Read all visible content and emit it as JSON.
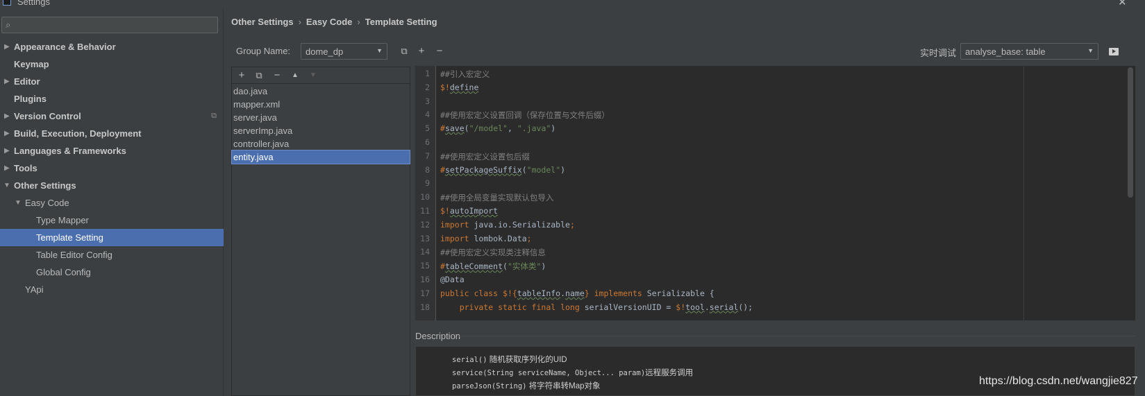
{
  "window": {
    "title": "Settings",
    "close_glyph": "✕"
  },
  "search": {
    "placeholder": "",
    "icon": "search-icon"
  },
  "sidebar": {
    "items": [
      {
        "label": "Appearance & Behavior",
        "arrow": "▶"
      },
      {
        "label": "Keymap",
        "arrow": ""
      },
      {
        "label": "Editor",
        "arrow": "▶"
      },
      {
        "label": "Plugins",
        "arrow": ""
      },
      {
        "label": "Version Control",
        "arrow": "▶"
      },
      {
        "label": "Build, Execution, Deployment",
        "arrow": "▶"
      },
      {
        "label": "Languages & Frameworks",
        "arrow": "▶"
      },
      {
        "label": "Tools",
        "arrow": "▶"
      },
      {
        "label": "Other Settings",
        "arrow": "▼"
      },
      {
        "label": "Easy Code",
        "arrow": "▼"
      },
      {
        "label": "Type Mapper",
        "arrow": ""
      },
      {
        "label": "Template Setting",
        "arrow": ""
      },
      {
        "label": "Table Editor Config",
        "arrow": ""
      },
      {
        "label": "Global Config",
        "arrow": ""
      },
      {
        "label": "YApi",
        "arrow": ""
      }
    ],
    "copy_icon": "⧉"
  },
  "breadcrumb": {
    "items": [
      "Other Settings",
      "Easy Code",
      "Template Setting"
    ],
    "separator": "›"
  },
  "group": {
    "label": "Group Name:",
    "value": "dome_dp",
    "dropdown_glyph": "▼",
    "copy_glyph": "⧉",
    "add_glyph": "+",
    "remove_glyph": "−"
  },
  "debug": {
    "label": "实时调试",
    "value": "analyse_base: table",
    "dropdown_glyph": "▼"
  },
  "file_toolbar": {
    "add": "+",
    "copy": "⧉",
    "remove": "−",
    "up": "▲",
    "down": "▼"
  },
  "files": [
    "dao.java",
    "mapper.xml",
    "server.java",
    "serverImp.java",
    "controller.java",
    "entity.java"
  ],
  "editor": {
    "line_numbers": [
      "1",
      "2",
      "3",
      "4",
      "5",
      "6",
      "7",
      "8",
      "9",
      "10",
      "11",
      "12",
      "13",
      "14",
      "15",
      "16",
      "17",
      "18"
    ],
    "lines": [
      [
        {
          "t": "##引入宏定义",
          "c": "cmt"
        }
      ],
      [
        {
          "t": "$!",
          "c": "dir"
        },
        {
          "t": "define",
          "c": "txt",
          "s": true
        }
      ],
      [],
      [
        {
          "t": "##使用宏定义设置回调（保存位置与文件后缀）",
          "c": "cmt"
        }
      ],
      [
        {
          "t": "#",
          "c": "dir"
        },
        {
          "t": "save",
          "c": "txt",
          "s": true
        },
        {
          "t": "(",
          "c": "txt"
        },
        {
          "t": "\"/model\"",
          "c": "str"
        },
        {
          "t": ", ",
          "c": "txt"
        },
        {
          "t": "\".java\"",
          "c": "str"
        },
        {
          "t": ")",
          "c": "txt"
        }
      ],
      [],
      [
        {
          "t": "##使用宏定义设置包后缀",
          "c": "cmt"
        }
      ],
      [
        {
          "t": "#",
          "c": "dir"
        },
        {
          "t": "setPackageSuffix",
          "c": "txt",
          "s": true
        },
        {
          "t": "(",
          "c": "txt"
        },
        {
          "t": "\"model\"",
          "c": "str"
        },
        {
          "t": ")",
          "c": "txt"
        }
      ],
      [],
      [
        {
          "t": "##使用全局变量实现默认包导入",
          "c": "cmt"
        }
      ],
      [
        {
          "t": "$!",
          "c": "dir"
        },
        {
          "t": "autoImport",
          "c": "txt",
          "s": true
        }
      ],
      [
        {
          "t": "import",
          "c": "dir"
        },
        {
          "t": " java.io.Serializable",
          "c": "txt"
        },
        {
          "t": ";",
          "c": "dir"
        }
      ],
      [
        {
          "t": "import",
          "c": "dir"
        },
        {
          "t": " lombok.Data",
          "c": "txt"
        },
        {
          "t": ";",
          "c": "dir"
        }
      ],
      [
        {
          "t": "##使用宏定义实现类注释信息",
          "c": "cmt"
        }
      ],
      [
        {
          "t": "#",
          "c": "dir"
        },
        {
          "t": "tableComment",
          "c": "txt",
          "s": true
        },
        {
          "t": "(",
          "c": "txt"
        },
        {
          "t": "\"实体类\"",
          "c": "str"
        },
        {
          "t": ")",
          "c": "txt"
        }
      ],
      [
        {
          "t": "@Data",
          "c": "txt"
        }
      ],
      [
        {
          "t": "public class ",
          "c": "dir"
        },
        {
          "t": "$!{",
          "c": "dir"
        },
        {
          "t": "tableInfo",
          "c": "txt",
          "s": true
        },
        {
          "t": ".",
          "c": "txt"
        },
        {
          "t": "name",
          "c": "txt",
          "s": true
        },
        {
          "t": "}",
          "c": "dir"
        },
        {
          "t": " implements ",
          "c": "dir"
        },
        {
          "t": "Serializable {",
          "c": "txt"
        }
      ],
      [
        {
          "t": "    private static final long ",
          "c": "dir"
        },
        {
          "t": "serialVersionUID = ",
          "c": "txt"
        },
        {
          "t": "$!",
          "c": "dir"
        },
        {
          "t": "tool",
          "c": "txt",
          "s": true
        },
        {
          "t": ".",
          "c": "txt"
        },
        {
          "t": "serial",
          "c": "txt",
          "s": true
        },
        {
          "t": "();",
          "c": "txt"
        }
      ]
    ]
  },
  "description": {
    "label": "Description",
    "lines": [
      {
        "code": "serial()",
        "text": " 随机获取序列化的UID"
      },
      {
        "code": "service(String serviceName, Object... param)",
        "text": "远程服务调用"
      },
      {
        "code": "parseJson(String)",
        "text": " 将字符串转Map对象"
      }
    ]
  },
  "watermark": "https://blog.csdn.net/wangjie827"
}
